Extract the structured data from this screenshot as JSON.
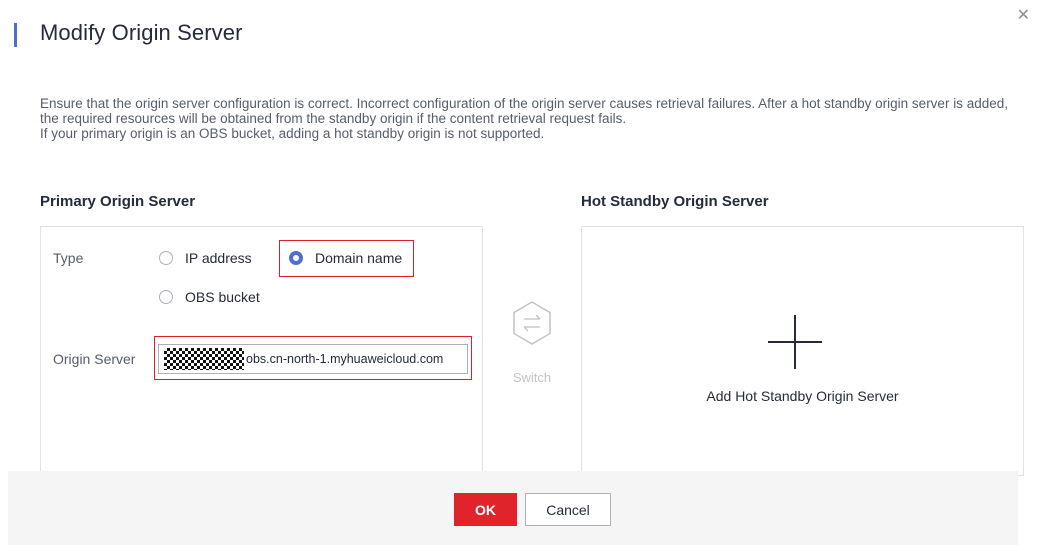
{
  "dialog": {
    "title": "Modify Origin Server",
    "close_icon": "close-icon",
    "description": [
      "Ensure that the origin server configuration is correct. Incorrect configuration of the origin server causes retrieval failures. After a hot standby origin server is added, the required resources will be obtained from the standby origin if the content retrieval request fails.",
      "If your primary origin is an OBS bucket, adding a hot standby origin is not supported."
    ]
  },
  "primary": {
    "section_title": "Primary Origin Server",
    "type_label": "Type",
    "options": [
      "IP address",
      "Domain name",
      "OBS bucket"
    ],
    "selected": "Domain name",
    "origin_label": "Origin Server",
    "origin_value": "obs.cn-north-1.myhuaweicloud.com"
  },
  "switch": {
    "label": "Switch",
    "icon": "switch-arrows-icon"
  },
  "standby": {
    "section_title": "Hot Standby Origin Server",
    "add_label": "Add Hot Standby Origin Server",
    "add_icon": "plus-icon"
  },
  "footer": {
    "ok_label": "OK",
    "cancel_label": "Cancel"
  },
  "colors": {
    "accent": "#526ecc",
    "primary_button": "#e1232b",
    "highlight": "#d9212a"
  }
}
